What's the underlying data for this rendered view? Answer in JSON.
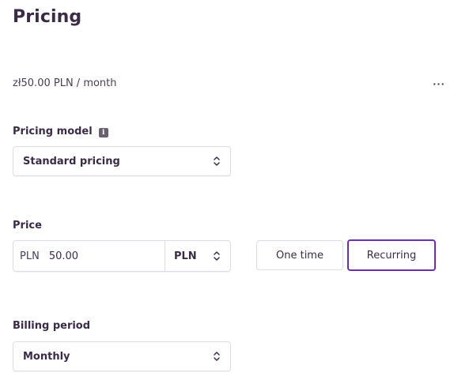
{
  "header": {
    "title": "Pricing"
  },
  "summary": {
    "text": "zł50.00 PLN / month",
    "more_label": "···"
  },
  "pricing_model": {
    "label": "Pricing model",
    "info_icon_glyph": "i",
    "selected": "Standard pricing"
  },
  "price": {
    "label": "Price",
    "prefix": "PLN",
    "amount": "50.00",
    "currency": "PLN"
  },
  "price_type": {
    "options": [
      {
        "label": "One time",
        "selected": false
      },
      {
        "label": "Recurring",
        "selected": true
      }
    ]
  },
  "billing_period": {
    "label": "Billing period",
    "selected": "Monthly"
  },
  "colors": {
    "accent": "#6b2fb0",
    "text": "#3a2c45",
    "border": "#e1dbe6"
  },
  "icons": {
    "select_chevron": "chevron-up-down-icon",
    "info": "info-icon",
    "more": "more-horizontal-icon"
  }
}
